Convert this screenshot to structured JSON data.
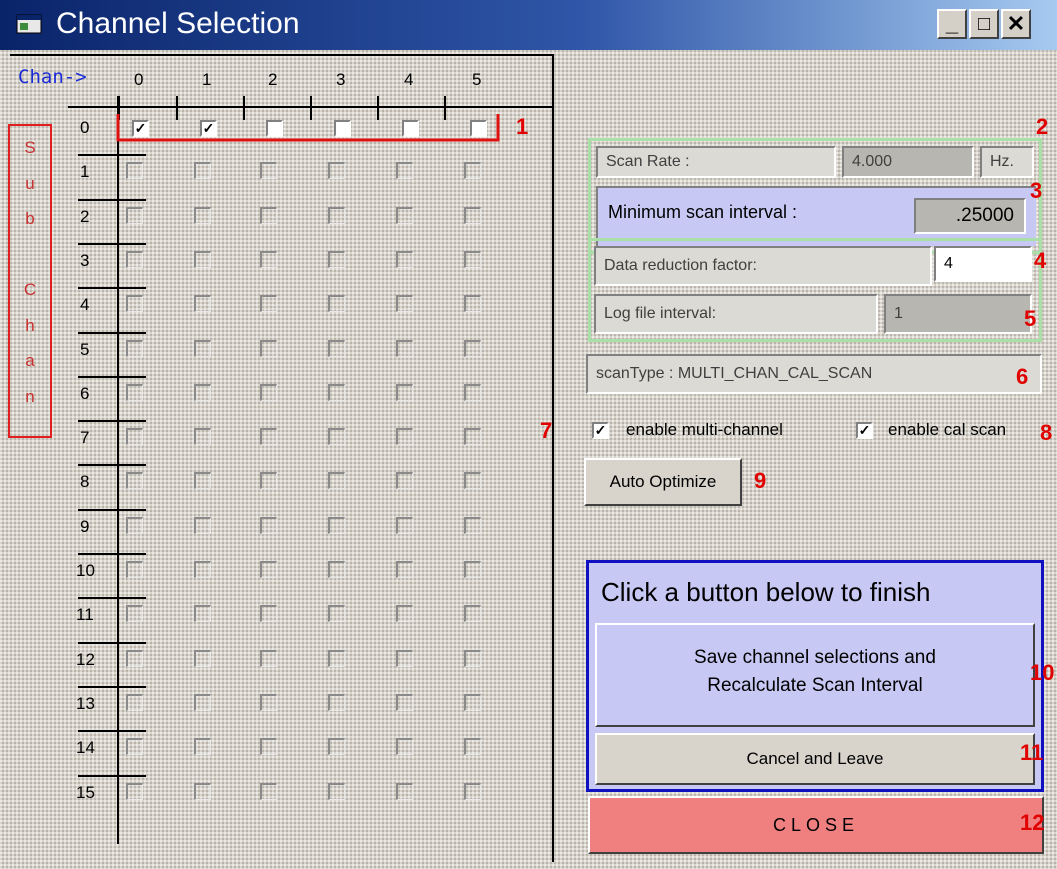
{
  "window": {
    "title": "Channel Selection",
    "minimize_label": "_",
    "maximize_label": "□",
    "close_label": "✕"
  },
  "grid": {
    "chan_label": "Chan->",
    "columns": [
      "0",
      "1",
      "2",
      "3",
      "4",
      "5"
    ],
    "rows": [
      "0",
      "1",
      "2",
      "3",
      "4",
      "5",
      "6",
      "7",
      "8",
      "9",
      "10",
      "11",
      "12",
      "13",
      "14",
      "15"
    ],
    "sub_chan_letters": [
      "S",
      "u",
      "b",
      "",
      "C",
      "h",
      "a",
      "n"
    ],
    "row0_checked": [
      true,
      true,
      false,
      false,
      false,
      false
    ]
  },
  "annotations": [
    "1",
    "2",
    "3",
    "4",
    "5",
    "6",
    "7",
    "8",
    "9",
    "10",
    "11",
    "12"
  ],
  "scan": {
    "rate_label": "Scan Rate :",
    "rate_value": "4.000",
    "rate_unit": "Hz.",
    "min_interval_label": "Minimum scan interval :",
    "min_interval_value": ".25000"
  },
  "data": {
    "reduction_label": "Data reduction factor:",
    "reduction_value": "4",
    "log_interval_label": "Log file interval:",
    "log_interval_value": "1"
  },
  "scan_type": "scanType : MULTI_CHAN_CAL_SCAN",
  "options": {
    "multi_channel_label": "enable multi-channel",
    "multi_channel_checked": true,
    "cal_scan_label": "enable cal scan",
    "cal_scan_checked": true
  },
  "buttons": {
    "auto_optimize": "Auto Optimize",
    "finish_prompt": "Click a button below to finish",
    "save_line1": "Save channel selections and",
    "save_line2": "Recalculate Scan Interval",
    "cancel": "Cancel and Leave",
    "close": "CLOSE"
  },
  "colors": {
    "titlebar_start": "#0a246a",
    "group_border": "#a8e0a8",
    "finish_panel": "#c8c8f4",
    "close_button": "#f08080",
    "annotation": "#e00000"
  }
}
